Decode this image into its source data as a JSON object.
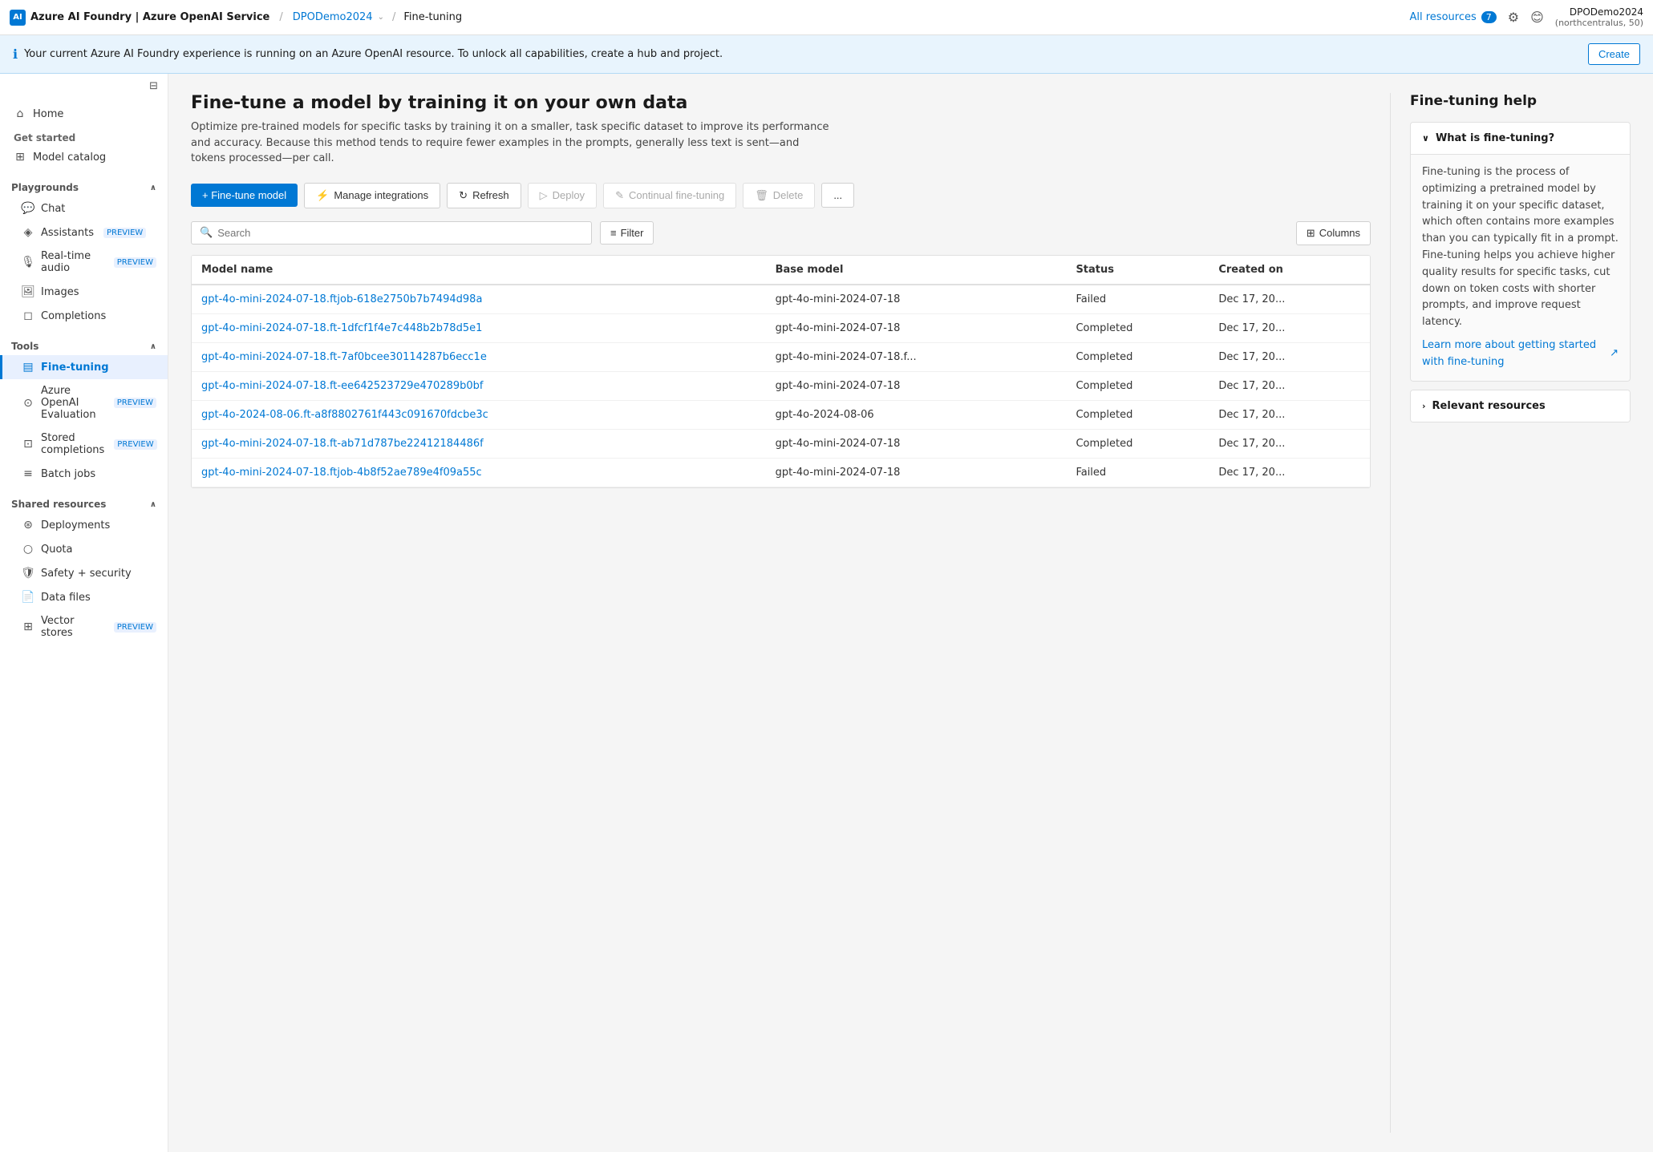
{
  "topbar": {
    "logo_text": "Azure AI Foundry | Azure OpenAI Service",
    "breadcrumb_workspace": "DPODemo2024",
    "breadcrumb_page": "Fine-tuning",
    "all_resources_label": "All resources",
    "badge_count": "7",
    "user_name": "DPODemo2024",
    "user_location": "(northcentralus, 50)"
  },
  "info_banner": {
    "message": "Your current Azure AI Foundry experience is running on an Azure OpenAI resource. To unlock all capabilities, create a hub and project.",
    "create_label": "Create"
  },
  "sidebar": {
    "toggle_icon": "☰",
    "home_label": "Home",
    "get_started_label": "Get started",
    "model_catalog_label": "Model catalog",
    "playgrounds_label": "Playgrounds",
    "playgrounds_chevron": "∧",
    "chat_label": "Chat",
    "assistants_label": "Assistants",
    "assistants_preview": "PREVIEW",
    "realtime_audio_label": "Real-time audio",
    "realtime_audio_preview": "PREVIEW",
    "images_label": "Images",
    "completions_label": "Completions",
    "tools_label": "Tools",
    "tools_chevron": "∧",
    "fine_tuning_label": "Fine-tuning",
    "azure_openai_eval_label": "Azure OpenAI Evaluation",
    "azure_openai_eval_preview": "PREVIEW",
    "stored_completions_label": "Stored completions",
    "stored_completions_preview": "PREVIEW",
    "batch_jobs_label": "Batch jobs",
    "shared_resources_label": "Shared resources",
    "shared_resources_chevron": "∧",
    "deployments_label": "Deployments",
    "quota_label": "Quota",
    "safety_security_label": "Safety + security",
    "data_files_label": "Data files",
    "vector_stores_label": "Vector stores",
    "vector_stores_preview": "PREVIEW"
  },
  "page": {
    "title": "Fine-tune a model by training it on your own data",
    "description": "Optimize pre-trained models for specific tasks by training it on a smaller, task specific dataset to improve its performance and accuracy. Because this method tends to require fewer examples in the prompts, generally less text is sent—and tokens processed—per call.",
    "toolbar": {
      "fine_tune_model": "+ Fine-tune model",
      "manage_integrations": "Manage integrations",
      "refresh": "Refresh",
      "deploy": "Deploy",
      "continual_fine_tuning": "Continual fine-tuning",
      "delete": "Delete",
      "more": "..."
    },
    "search_placeholder": "Search",
    "filter_label": "Filter",
    "columns_label": "Columns",
    "table": {
      "columns": [
        "Model name",
        "Base model",
        "Status",
        "Created on"
      ],
      "rows": [
        {
          "model_name": "gpt-4o-mini-2024-07-18.ftjob-618e2750b7b7494d98a",
          "base_model": "gpt-4o-mini-2024-07-18",
          "status": "Failed",
          "created_on": "Dec 17, 20..."
        },
        {
          "model_name": "gpt-4o-mini-2024-07-18.ft-1dfcf1f4e7c448b2b78d5e1",
          "base_model": "gpt-4o-mini-2024-07-18",
          "status": "Completed",
          "created_on": "Dec 17, 20..."
        },
        {
          "model_name": "gpt-4o-mini-2024-07-18.ft-7af0bcee30114287b6ecc1e",
          "base_model": "gpt-4o-mini-2024-07-18.f...",
          "status": "Completed",
          "created_on": "Dec 17, 20..."
        },
        {
          "model_name": "gpt-4o-mini-2024-07-18.ft-ee642523729e470289b0bf",
          "base_model": "gpt-4o-mini-2024-07-18",
          "status": "Completed",
          "created_on": "Dec 17, 20..."
        },
        {
          "model_name": "gpt-4o-2024-08-06.ft-a8f8802761f443c091670fdcbe3c",
          "base_model": "gpt-4o-2024-08-06",
          "status": "Completed",
          "created_on": "Dec 17, 20..."
        },
        {
          "model_name": "gpt-4o-mini-2024-07-18.ft-ab71d787be22412184486f",
          "base_model": "gpt-4o-mini-2024-07-18",
          "status": "Completed",
          "created_on": "Dec 17, 20..."
        },
        {
          "model_name": "gpt-4o-mini-2024-07-18.ftjob-4b8f52ae789e4f09a55c",
          "base_model": "gpt-4o-mini-2024-07-18",
          "status": "Failed",
          "created_on": "Dec 17, 20..."
        }
      ]
    }
  },
  "help_panel": {
    "title": "Fine-tuning help",
    "section1": {
      "label": "What is fine-tuning?",
      "expanded": true,
      "body": "Fine-tuning is the process of optimizing a pretrained model by training it on your specific dataset, which often contains more examples than you can typically fit in a prompt. Fine-tuning helps you achieve higher quality results for specific tasks, cut down on token costs with shorter prompts, and improve request latency.",
      "link_text": "Learn more about getting started with fine-tuning",
      "link_icon": "↗"
    },
    "section2": {
      "label": "Relevant resources",
      "expanded": false
    }
  },
  "colors": {
    "primary": "#0078d4",
    "completed": "#107c10",
    "failed": "#d13438",
    "active_sidebar": "#0078d4"
  }
}
